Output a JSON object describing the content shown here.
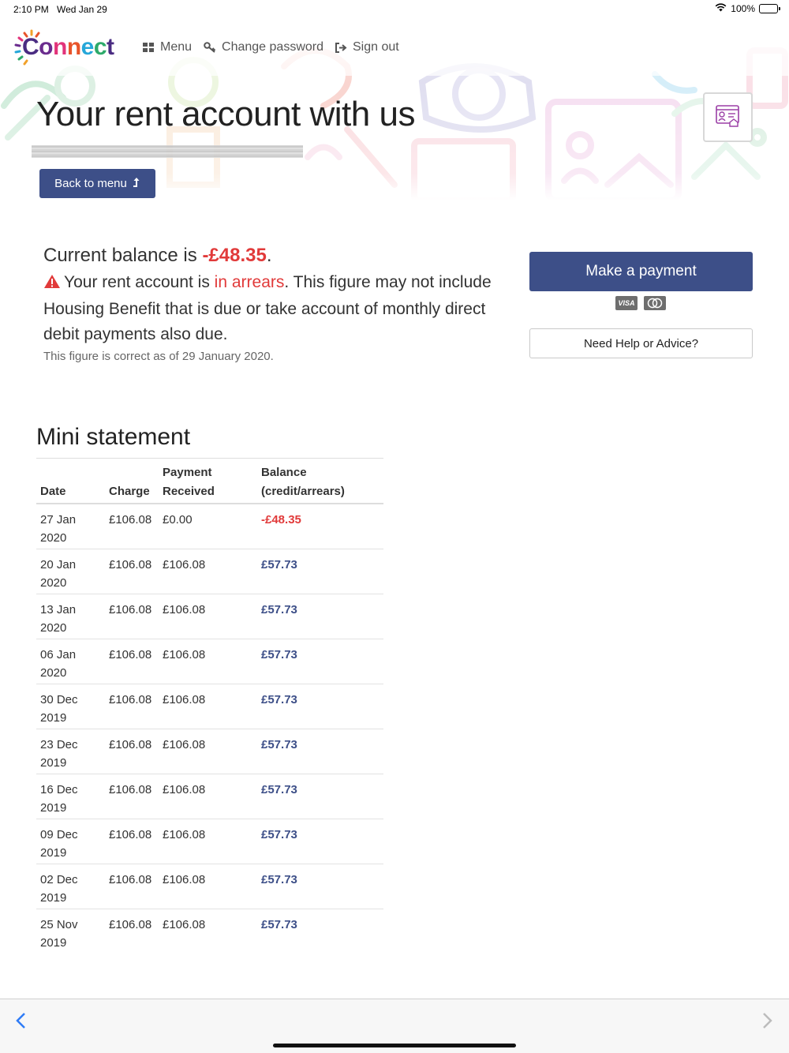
{
  "status_bar": {
    "time": "2:10 PM",
    "date": "Wed Jan 29",
    "battery": "100%"
  },
  "header": {
    "logo_letters": [
      "C",
      "o",
      "n",
      "n",
      "e",
      "c",
      "t"
    ],
    "nav": [
      {
        "label": "Menu",
        "icon": "grid-icon"
      },
      {
        "label": "Change password",
        "icon": "key-icon"
      },
      {
        "label": "Sign out",
        "icon": "sign-out-icon"
      }
    ]
  },
  "page": {
    "title": "Your rent account with us",
    "back_label": "Back to menu"
  },
  "balance": {
    "prefix": "Current balance is ",
    "amount": "-£48.35",
    "suffix": ".",
    "arrears_prefix": "Your rent account is ",
    "arrears_word": "in arrears",
    "arrears_suffix": ". This figure may not include Housing Benefit that is due or take account of monthly direct debit payments also due.",
    "correct_as": "This figure is correct as of 29 January 2020."
  },
  "actions": {
    "pay_label": "Make a payment",
    "cards": [
      "VISA",
      "mastercard"
    ],
    "help_label": "Need Help or Advice?"
  },
  "statement": {
    "title": "Mini statement",
    "headers": {
      "date": "Date",
      "charge": "Charge",
      "paid_1": "Payment",
      "paid_2": "Received",
      "bal_1": "Balance",
      "bal_2": "(credit/arrears)"
    },
    "rows": [
      {
        "date_1": "27 Jan",
        "date_2": "2020",
        "charge": "£106.08",
        "paid": "£0.00",
        "balance": "-£48.35"
      },
      {
        "date_1": "20 Jan",
        "date_2": "2020",
        "charge": "£106.08",
        "paid": "£106.08",
        "balance": "£57.73"
      },
      {
        "date_1": "13 Jan",
        "date_2": "2020",
        "charge": "£106.08",
        "paid": "£106.08",
        "balance": "£57.73"
      },
      {
        "date_1": "06 Jan",
        "date_2": "2020",
        "charge": "£106.08",
        "paid": "£106.08",
        "balance": "£57.73"
      },
      {
        "date_1": "30 Dec",
        "date_2": "2019",
        "charge": "£106.08",
        "paid": "£106.08",
        "balance": "£57.73"
      },
      {
        "date_1": "23 Dec",
        "date_2": "2019",
        "charge": "£106.08",
        "paid": "£106.08",
        "balance": "£57.73"
      },
      {
        "date_1": "16 Dec",
        "date_2": "2019",
        "charge": "£106.08",
        "paid": "£106.08",
        "balance": "£57.73"
      },
      {
        "date_1": "09 Dec",
        "date_2": "2019",
        "charge": "£106.08",
        "paid": "£106.08",
        "balance": "£57.73"
      },
      {
        "date_1": "02 Dec",
        "date_2": "2019",
        "charge": "£106.08",
        "paid": "£106.08",
        "balance": "£57.73"
      },
      {
        "date_1": "25 Nov",
        "date_2": "2019",
        "charge": "£106.08",
        "paid": "£106.08",
        "balance": "£57.73"
      }
    ]
  },
  "colors": {
    "brand_blue": "#3d4f88",
    "arrears_red": "#e13a3a",
    "ios_blue": "#2f7cf6"
  },
  "icons": {
    "back": "chevron-left-icon",
    "forward": "chevron-right-icon",
    "corner": "id-card-icon",
    "warning": "warning-triangle-icon"
  }
}
